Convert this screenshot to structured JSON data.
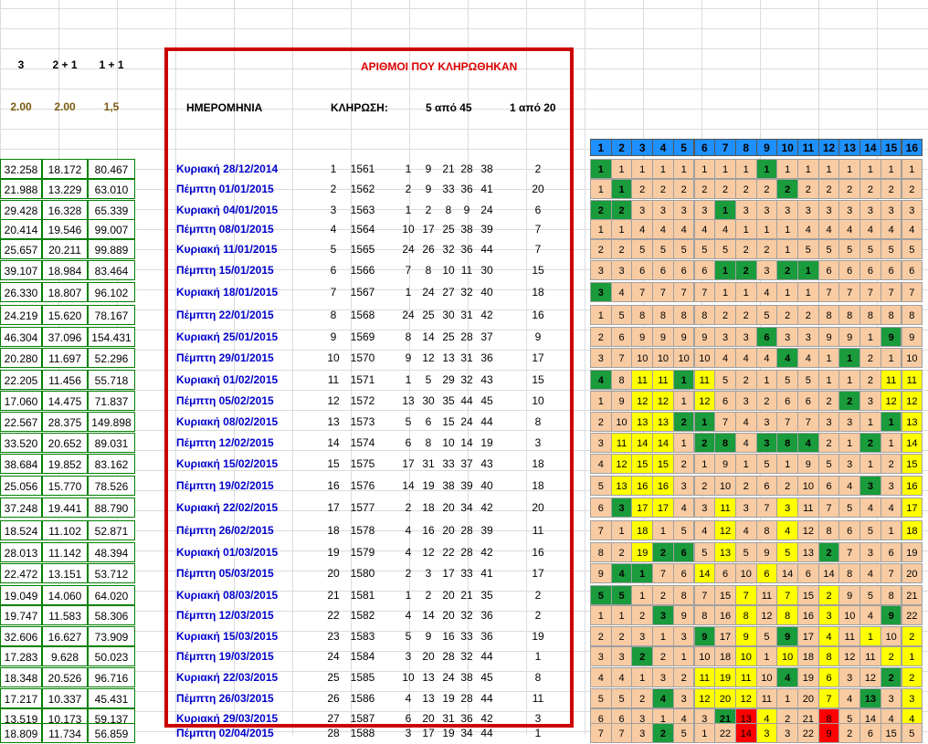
{
  "left_headers": [
    "3",
    "2 + 1",
    "1 + 1"
  ],
  "left_odds": [
    "2.00",
    "2.00",
    "1,5"
  ],
  "box": {
    "title": "ΑΡΙΘΜΟΙ ΠΟΥ ΚΛΗΡΩΘΗΚΑΝ",
    "date_header": "ΗΜΕΡΟΜΗΝΙΑ",
    "draw_header": "ΚΛΗΡΩΣΗ:",
    "five_header": "5 από 45",
    "one_header": "1 από 20"
  },
  "grid_header": [
    "1",
    "2",
    "3",
    "4",
    "5",
    "6",
    "7",
    "8",
    "9",
    "10",
    "11",
    "12",
    "13",
    "14",
    "15",
    "16"
  ],
  "rows": [
    {
      "c": [
        "32.258",
        "18.172",
        "80.467"
      ],
      "date": "Κυριακή 28/12/2014",
      "idx": "1",
      "draw": "1561",
      "n": [
        "1",
        "9",
        "21",
        "28",
        "38"
      ],
      "one": "2",
      "grid": [
        "1",
        "1",
        "1",
        "1",
        "1",
        "1",
        "1",
        "1",
        "1",
        "1",
        "1",
        "1",
        "1",
        "1",
        "1",
        "1"
      ],
      "st": "gooooooogoooooooo"
    },
    {
      "c": [
        "21.988",
        "13.229",
        "63.010"
      ],
      "date": "Πέμπτη 01/01/2015",
      "idx": "2",
      "draw": "1562",
      "n": [
        "2",
        "9",
        "33",
        "36",
        "41"
      ],
      "one": "20",
      "grid": [
        "1",
        "1",
        "2",
        "2",
        "2",
        "2",
        "2",
        "2",
        "2",
        "2",
        "2",
        "2",
        "2",
        "2",
        "2",
        "2"
      ],
      "st": "ogooooooogooooooo"
    },
    {
      "c": [
        "29.428",
        "16.328",
        "65.339"
      ],
      "date": "Κυριακή 04/01/2015",
      "idx": "3",
      "draw": "1563",
      "n": [
        "1",
        "2",
        "8",
        "9",
        "24"
      ],
      "one": "6",
      "grid": [
        "2",
        "2",
        "3",
        "3",
        "3",
        "3",
        "1",
        "3",
        "3",
        "3",
        "3",
        "3",
        "3",
        "3",
        "3",
        "3"
      ],
      "st": "ggoooogoooooooooo"
    },
    {
      "c": [
        "20.414",
        "19.546",
        "99.007"
      ],
      "date": "Πέμπτη 08/01/2015",
      "idx": "4",
      "draw": "1564",
      "n": [
        "10",
        "17",
        "25",
        "38",
        "39"
      ],
      "one": "7",
      "grid": [
        "1",
        "1",
        "4",
        "4",
        "4",
        "4",
        "4",
        "1",
        "1",
        "1",
        "4",
        "4",
        "4",
        "4",
        "4",
        "4"
      ],
      "st": "oooooooooooooooo"
    },
    {
      "c": [
        "25.657",
        "20.211",
        "99.889"
      ],
      "date": "Κυριακή 11/01/2015",
      "idx": "5",
      "draw": "1565",
      "n": [
        "24",
        "26",
        "32",
        "36",
        "44"
      ],
      "one": "7",
      "grid": [
        "2",
        "2",
        "5",
        "5",
        "5",
        "5",
        "5",
        "2",
        "2",
        "1",
        "5",
        "5",
        "5",
        "5",
        "5",
        "5"
      ],
      "st": "oooooooooooooooo"
    },
    {
      "c": [
        "39.107",
        "18.984",
        "83.464"
      ],
      "date": "Πέμπτη 15/01/2015",
      "idx": "6",
      "draw": "1566",
      "n": [
        "7",
        "8",
        "10",
        "11",
        "30"
      ],
      "one": "15",
      "grid": [
        "3",
        "3",
        "6",
        "6",
        "6",
        "6",
        "1",
        "2",
        "3",
        "2",
        "1",
        "6",
        "6",
        "6",
        "6",
        "6"
      ],
      "st": "ooooooggoggoooooo"
    },
    {
      "c": [
        "26.330",
        "18.807",
        "96.102"
      ],
      "date": "Κυριακή 18/01/2015",
      "idx": "7",
      "draw": "1567",
      "n": [
        "1",
        "24",
        "27",
        "32",
        "40"
      ],
      "one": "18",
      "grid": [
        "3",
        "4",
        "7",
        "7",
        "7",
        "7",
        "1",
        "1",
        "4",
        "1",
        "1",
        "7",
        "7",
        "7",
        "7",
        "7"
      ],
      "st": "goooooooooooooooo"
    },
    {
      "c": [
        "24.219",
        "15.620",
        "78.167"
      ],
      "date": "Πέμπτη 22/01/2015",
      "idx": "8",
      "draw": "1568",
      "n": [
        "24",
        "25",
        "30",
        "31",
        "42"
      ],
      "one": "16",
      "grid": [
        "1",
        "5",
        "8",
        "8",
        "8",
        "8",
        "2",
        "2",
        "5",
        "2",
        "2",
        "8",
        "8",
        "8",
        "8",
        "8"
      ],
      "st": "oooooooooooooooo"
    },
    {
      "c": [
        "46.304",
        "37.096",
        "154.431"
      ],
      "date": "Κυριακή 25/01/2015",
      "idx": "9",
      "draw": "1569",
      "n": [
        "8",
        "14",
        "25",
        "28",
        "37"
      ],
      "one": "9",
      "grid": [
        "2",
        "6",
        "9",
        "9",
        "9",
        "9",
        "3",
        "3",
        "6",
        "3",
        "3",
        "9",
        "9",
        "1",
        "9",
        "9"
      ],
      "st": "oooooooogooooogoo"
    },
    {
      "c": [
        "20.280",
        "11.697",
        "52.296"
      ],
      "date": "Πέμπτη 29/01/2015",
      "idx": "10",
      "draw": "1570",
      "n": [
        "9",
        "12",
        "13",
        "31",
        "36"
      ],
      "one": "17",
      "grid": [
        "3",
        "7",
        "10",
        "10",
        "10",
        "10",
        "4",
        "4",
        "4",
        "4",
        "4",
        "1",
        "1",
        "2",
        "1",
        "10"
      ],
      "st": "ooooooooogoogoooo"
    },
    {
      "c": [
        "22.205",
        "11.456",
        "55.718"
      ],
      "date": "Κυριακή 01/02/2015",
      "idx": "11",
      "draw": "1571",
      "n": [
        "1",
        "5",
        "29",
        "32",
        "43"
      ],
      "one": "15",
      "grid": [
        "4",
        "8",
        "11",
        "11",
        "1",
        "11",
        "5",
        "2",
        "1",
        "5",
        "5",
        "1",
        "1",
        "2",
        "11",
        "11"
      ],
      "st": "goyygyooooooooyyo"
    },
    {
      "c": [
        "17.060",
        "14.475",
        "71.837"
      ],
      "date": "Πέμπτη 05/02/2015",
      "idx": "12",
      "draw": "1572",
      "n": [
        "13",
        "30",
        "35",
        "44",
        "45"
      ],
      "one": "10",
      "grid": [
        "1",
        "9",
        "12",
        "12",
        "1",
        "12",
        "6",
        "3",
        "2",
        "6",
        "6",
        "2",
        "2",
        "3",
        "12",
        "12"
      ],
      "st": "ooyyoyoooooogoyyo"
    },
    {
      "c": [
        "22.567",
        "28.375",
        "149.898"
      ],
      "date": "Κυριακή 08/02/2015",
      "idx": "13",
      "draw": "1573",
      "n": [
        "5",
        "6",
        "15",
        "24",
        "44"
      ],
      "one": "8",
      "grid": [
        "2",
        "10",
        "13",
        "13",
        "2",
        "1",
        "7",
        "4",
        "3",
        "7",
        "7",
        "3",
        "3",
        "1",
        "1",
        "13"
      ],
      "st": "ooyyggoooooooogyo"
    },
    {
      "c": [
        "33.520",
        "20.652",
        "89.031"
      ],
      "date": "Πέμπτη 12/02/2015",
      "idx": "14",
      "draw": "1574",
      "n": [
        "6",
        "8",
        "10",
        "14",
        "19"
      ],
      "one": "3",
      "grid": [
        "3",
        "11",
        "14",
        "14",
        "1",
        "2",
        "8",
        "4",
        "3",
        "8",
        "4",
        "2",
        "1",
        "2",
        "1",
        "14"
      ],
      "st": "oyyyoggogggoogoyo"
    },
    {
      "c": [
        "38.684",
        "19.852",
        "83.162"
      ],
      "date": "Κυριακή 15/02/2015",
      "idx": "15",
      "draw": "1575",
      "n": [
        "17",
        "31",
        "33",
        "37",
        "43"
      ],
      "one": "18",
      "grid": [
        "4",
        "12",
        "15",
        "15",
        "2",
        "1",
        "9",
        "1",
        "5",
        "1",
        "9",
        "5",
        "3",
        "1",
        "2",
        "15"
      ],
      "st": "oyyyoooooooooooyo"
    },
    {
      "c": [
        "25.056",
        "15.770",
        "78.526"
      ],
      "date": "Πέμπτη 19/02/2015",
      "idx": "16",
      "draw": "1576",
      "n": [
        "14",
        "19",
        "38",
        "39",
        "40"
      ],
      "one": "18",
      "grid": [
        "5",
        "13",
        "16",
        "16",
        "3",
        "2",
        "10",
        "2",
        "6",
        "2",
        "10",
        "6",
        "4",
        "3",
        "3",
        "16"
      ],
      "st": "oyyyooooooooogoyo"
    },
    {
      "c": [
        "37.248",
        "19.441",
        "88.790"
      ],
      "date": "Κυριακή 22/02/2015",
      "idx": "17",
      "draw": "1577",
      "n": [
        "2",
        "18",
        "20",
        "34",
        "42"
      ],
      "one": "20",
      "grid": [
        "6",
        "3",
        "17",
        "17",
        "4",
        "3",
        "11",
        "3",
        "7",
        "3",
        "11",
        "7",
        "5",
        "4",
        "4",
        "17"
      ],
      "st": "ogyyooyooyoooooyo"
    },
    {
      "c": [
        "18.524",
        "11.102",
        "52.871"
      ],
      "date": "Πέμπτη 26/02/2015",
      "idx": "18",
      "draw": "1578",
      "n": [
        "4",
        "16",
        "20",
        "28",
        "39"
      ],
      "one": "11",
      "grid": [
        "7",
        "1",
        "18",
        "1",
        "5",
        "4",
        "12",
        "4",
        "8",
        "4",
        "12",
        "8",
        "6",
        "5",
        "1",
        "18"
      ],
      "st": "ooyoooyooyoooooyg"
    },
    {
      "c": [
        "28.013",
        "11.142",
        "48.394"
      ],
      "date": "Κυριακή 01/03/2015",
      "idx": "19",
      "draw": "1579",
      "n": [
        "4",
        "12",
        "22",
        "28",
        "42"
      ],
      "one": "16",
      "grid": [
        "8",
        "2",
        "19",
        "2",
        "6",
        "5",
        "13",
        "5",
        "9",
        "5",
        "13",
        "2",
        "7",
        "3",
        "6",
        "19"
      ],
      "st": "ooyggoyooyogooooo"
    },
    {
      "c": [
        "22.472",
        "13.151",
        "53.712"
      ],
      "date": "Πέμπτη 05/03/2015",
      "idx": "20",
      "draw": "1580",
      "n": [
        "2",
        "3",
        "17",
        "33",
        "41"
      ],
      "one": "17",
      "grid": [
        "9",
        "4",
        "1",
        "7",
        "6",
        "14",
        "6",
        "10",
        "6",
        "14",
        "6",
        "14",
        "8",
        "4",
        "7",
        "20"
      ],
      "st": "oggooyooyoooooooo"
    },
    {
      "c": [
        "19.049",
        "14.060",
        "64.020"
      ],
      "date": "Κυριακή 08/03/2015",
      "idx": "21",
      "draw": "1581",
      "n": [
        "1",
        "2",
        "20",
        "21",
        "35"
      ],
      "one": "2",
      "grid": [
        "5",
        "5",
        "1",
        "2",
        "8",
        "7",
        "15",
        "7",
        "11",
        "7",
        "15",
        "2",
        "9",
        "5",
        "8",
        "21"
      ],
      "st": "ggoooooyoyoyooooo"
    },
    {
      "c": [
        "19.747",
        "11.583",
        "58.306"
      ],
      "date": "Πέμπτη 12/03/2015",
      "idx": "22",
      "draw": "1582",
      "n": [
        "4",
        "14",
        "20",
        "32",
        "36"
      ],
      "one": "2",
      "grid": [
        "1",
        "1",
        "2",
        "3",
        "9",
        "8",
        "16",
        "8",
        "12",
        "8",
        "16",
        "3",
        "10",
        "4",
        "9",
        "22"
      ],
      "st": "ooogoooyoyoyoogoo"
    },
    {
      "c": [
        "32.606",
        "16.627",
        "73.909"
      ],
      "date": "Κυριακή 15/03/2015",
      "idx": "23",
      "draw": "1583",
      "n": [
        "5",
        "9",
        "16",
        "33",
        "36"
      ],
      "one": "19",
      "grid": [
        "2",
        "2",
        "3",
        "1",
        "3",
        "9",
        "17",
        "9",
        "5",
        "9",
        "17",
        "4",
        "11",
        "1",
        "10",
        "2"
      ],
      "st": "ooooogoyogoyoyoyg"
    },
    {
      "c": [
        "17.283",
        "9.628",
        "50.023"
      ],
      "date": "Πέμπτη 19/03/2015",
      "idx": "24",
      "draw": "1584",
      "n": [
        "3",
        "20",
        "28",
        "32",
        "44"
      ],
      "one": "1",
      "grid": [
        "3",
        "3",
        "2",
        "2",
        "1",
        "10",
        "18",
        "10",
        "1",
        "10",
        "18",
        "8",
        "12",
        "11",
        "2",
        "1"
      ],
      "st": "oogooooyoyoyooyyo"
    },
    {
      "c": [
        "18.348",
        "20.526",
        "96.716"
      ],
      "date": "Κυριακή 22/03/2015",
      "idx": "25",
      "draw": "1585",
      "n": [
        "10",
        "13",
        "24",
        "38",
        "45"
      ],
      "one": "8",
      "grid": [
        "4",
        "4",
        "1",
        "3",
        "2",
        "11",
        "19",
        "11",
        "10",
        "4",
        "19",
        "6",
        "3",
        "12",
        "2",
        "2"
      ],
      "st": "oooooyyyogoyoogyo"
    },
    {
      "c": [
        "17.217",
        "10.337",
        "45.431"
      ],
      "date": "Πέμπτη 26/03/2015",
      "idx": "26",
      "draw": "1586",
      "n": [
        "4",
        "13",
        "19",
        "28",
        "44"
      ],
      "one": "11",
      "grid": [
        "5",
        "5",
        "2",
        "4",
        "3",
        "12",
        "20",
        "12",
        "11",
        "1",
        "20",
        "7",
        "4",
        "13",
        "3",
        "3"
      ],
      "st": "ooogoyyyoooyogoyo"
    },
    {
      "c": [
        "13.519",
        "10.173",
        "59.137"
      ],
      "date": "Κυριακή 29/03/2015",
      "idx": "27",
      "draw": "1587",
      "n": [
        "6",
        "20",
        "31",
        "36",
        "42"
      ],
      "one": "3",
      "grid": [
        "6",
        "6",
        "3",
        "1",
        "4",
        "3",
        "21",
        "13",
        "4",
        "2",
        "21",
        "8",
        "5",
        "14",
        "4",
        "4"
      ],
      "st": "oooooogryooroooyo"
    },
    {
      "c": [
        "18.809",
        "11.734",
        "56.859"
      ],
      "date": "Πέμπτη 02/04/2015",
      "idx": "28",
      "draw": "1588",
      "n": [
        "3",
        "17",
        "19",
        "34",
        "44"
      ],
      "one": "1",
      "grid": [
        "7",
        "7",
        "3",
        "2",
        "5",
        "1",
        "22",
        "14",
        "3",
        "3",
        "22",
        "9",
        "2",
        "6",
        "15",
        "5"
      ],
      "st": "ooogoooryoorooooy"
    }
  ]
}
